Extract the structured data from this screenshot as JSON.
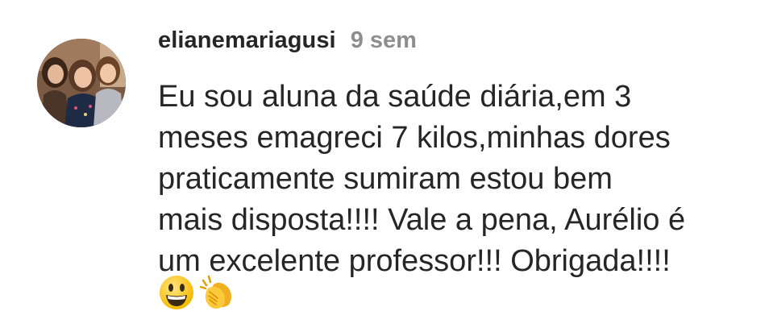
{
  "comment": {
    "username": "elianemariagusi",
    "time": "9 sem",
    "lines": [
      "Eu sou aluna da saúde diária,em 3",
      "meses emagreci 7 kilos,minhas dores",
      "praticamente sumiram estou bem",
      "mais disposta!!!! Vale a pena, Aurélio é",
      "um excelente professor!!! Obrigada!!!!"
    ],
    "emojis": [
      "grinning-face-icon",
      "clapping-hands-icon"
    ]
  },
  "colors": {
    "text": "#262626",
    "secondary": "#8e8e8e",
    "background": "#ffffff"
  }
}
